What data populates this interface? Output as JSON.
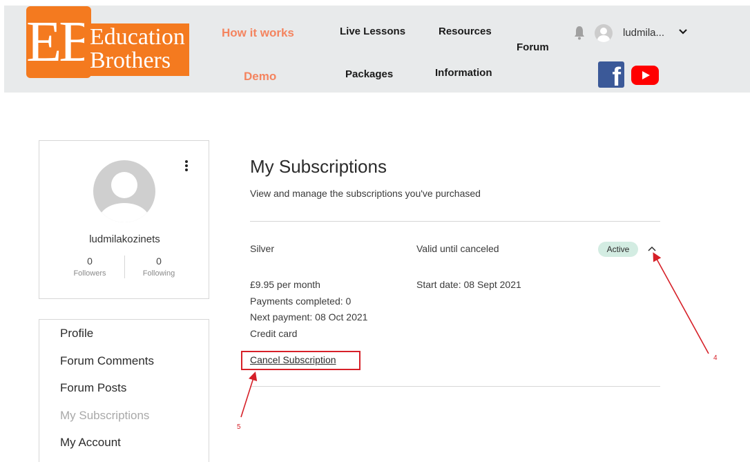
{
  "header": {
    "logo": {
      "mark": "EB",
      "line1": "Education",
      "line2": "Brothers"
    },
    "nav": {
      "how_it_works": "How it works",
      "demo": "Demo",
      "live_lessons": "Live Lessons",
      "packages": "Packages",
      "resources": "Resources",
      "information": "Information",
      "forum": "Forum"
    },
    "user": {
      "name": "ludmila...",
      "icons": [
        "bell-icon",
        "avatar",
        "chevron-down-icon"
      ]
    },
    "social": {
      "facebook_glyph": "f",
      "icons": [
        "facebook-icon",
        "youtube-icon"
      ]
    }
  },
  "profile": {
    "name": "ludmilakozinets",
    "followers_count": "0",
    "followers_label": "Followers",
    "following_count": "0",
    "following_label": "Following"
  },
  "side_menu": {
    "items": [
      "Profile",
      "Forum Comments",
      "Forum Posts",
      "My Subscriptions",
      "My Account"
    ],
    "active": "My Subscriptions"
  },
  "main": {
    "title": "My Subscriptions",
    "subtitle": "View and manage the subscriptions you've purchased",
    "subscription": {
      "plan": "Silver",
      "validity": "Valid until canceled",
      "status": "Active",
      "price": "£9.95 per month",
      "payments_completed": "Payments completed: 0",
      "next_payment": "Next payment: 08 Oct 2021",
      "payment_method": "Credit card",
      "start_date": "Start date: 08 Sept 2021",
      "cancel_label": "Cancel Subscription"
    }
  },
  "annotations": {
    "step_4": "4",
    "step_5": "5",
    "color": "#d62028"
  },
  "colors": {
    "brand_orange": "#f47a1f",
    "nav_orange": "#f4845f",
    "header_bg": "#e8eaeb",
    "active_badge": "#d3ece2",
    "facebook": "#3b5998",
    "youtube": "#ff0000"
  }
}
